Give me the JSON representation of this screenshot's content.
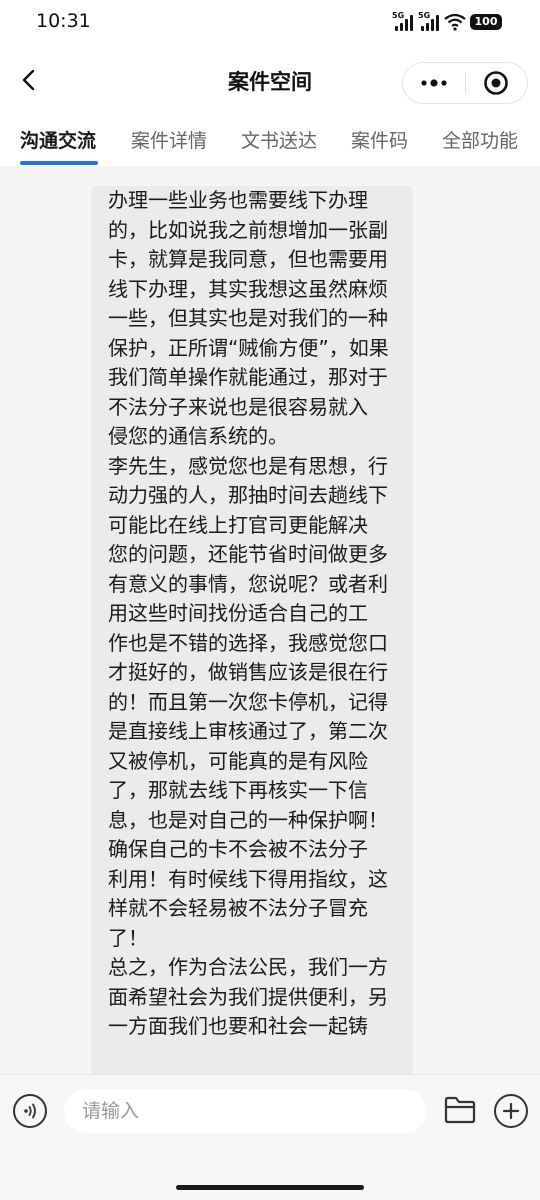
{
  "status_bar": {
    "time": "10:31",
    "signal_1_label": "5G",
    "signal_2_label": "5G",
    "battery": "100",
    "icons": [
      "signal-5g-icon",
      "signal-5g-icon",
      "wifi-icon",
      "battery-icon"
    ]
  },
  "nav": {
    "title": "案件空间",
    "icons": [
      "back-arrow-icon",
      "more-dots-icon",
      "target-close-icon"
    ]
  },
  "tabs": [
    {
      "label": "沟通交流",
      "active": true
    },
    {
      "label": "案件详情",
      "active": false
    },
    {
      "label": "文书送达",
      "active": false
    },
    {
      "label": "案件码",
      "active": false
    },
    {
      "label": "全部功能",
      "active": false
    }
  ],
  "message": {
    "lines": [
      "办理一些业务也需要线下办理",
      "的，比如说我之前想增加一张副",
      "卡，就算是我同意，但也需要用",
      "线下办理，其实我想这虽然麻烦",
      "一些，但其实也是对我们的一种",
      "保护，正所谓“贼偷方便”，如果",
      "我们简单操作就能通过，那对于",
      "不法分子来说也是很容易就入",
      "侵您的通信系统的。",
      "李先生，感觉您也是有思想，行",
      "动力强的人，那抽时间去趟线下",
      "可能比在线上打官司更能解决",
      "您的问题，还能节省时间做更多",
      "有意义的事情，您说呢？或者利",
      "用这些时间找份适合自己的工",
      "作也是不错的选择，我感觉您口",
      "才挺好的，做销售应该是很在行",
      "的！而且第一次您卡停机，记得",
      "是直接线上审核通过了，第二次",
      "又被停机，可能真的是有风险",
      "了，那就去线下再核实一下信",
      "息，也是对自己的一种保护啊！",
      "确保自己的卡不会被不法分子",
      "利用！有时候线下得用指纹，这",
      "样就不会轻易被不法分子冒充",
      "了！",
      "总之，作为合法公民，我们一方",
      "面希望社会为我们提供便利，另",
      "一方面我们也要和社会一起铸"
    ]
  },
  "input": {
    "placeholder": "请输入",
    "value": "",
    "icons": [
      "voice-icon",
      "folder-icon",
      "plus-icon"
    ]
  },
  "colors": {
    "accent": "#2a6ee8",
    "bubble": "#ebebeb",
    "background": "#f5f5f5"
  }
}
